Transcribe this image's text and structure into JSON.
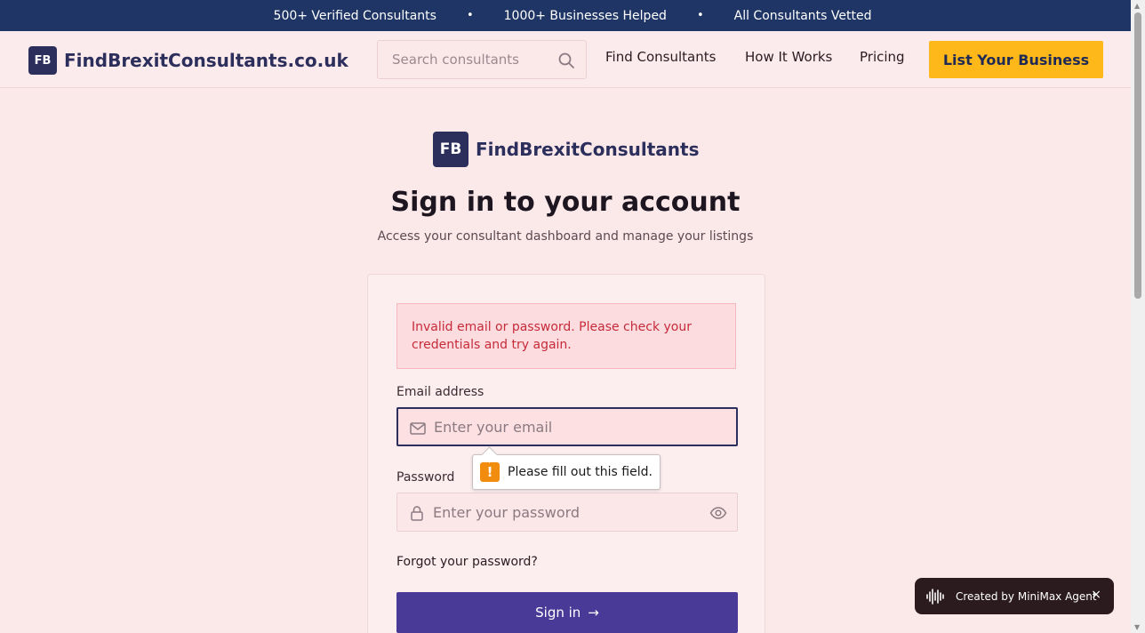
{
  "topbar": {
    "items": [
      "500+ Verified Consultants",
      "1000+ Businesses Helped",
      "All Consultants Vetted"
    ],
    "separator": "•"
  },
  "header": {
    "logo_text": "FB",
    "brand_name": "FindBrexitConsultants.co.uk",
    "search_placeholder": "Search consultants",
    "nav": {
      "find": "Find Consultants",
      "how": "How It Works",
      "pricing": "Pricing"
    },
    "cta_label": "List Your Business"
  },
  "main": {
    "logo_text": "FB",
    "logo_name": "FindBrexitConsultants",
    "title": "Sign in to your account",
    "subtitle": "Access your consultant dashboard and manage your listings",
    "error": "Invalid email or password. Please check your credentials and try again.",
    "email_label": "Email address",
    "email_placeholder": "Enter your email",
    "tooltip": "Please fill out this field.",
    "tooltip_icon": "!",
    "password_label": "Password",
    "password_placeholder": "Enter your password",
    "forgot": "Forgot your password?",
    "signin_label": "Sign in",
    "signin_arrow": "→"
  },
  "badge": {
    "text": "Created by MiniMax Agent",
    "close": "×"
  },
  "colors": {
    "topbar": "#1f3566",
    "brand": "#2c2e5c",
    "cta": "#ffb819",
    "primary_button": "#4a3a97",
    "error_text": "#c62b3a",
    "background": "#fbe9ea"
  },
  "icons": [
    "search-icon",
    "mail-icon",
    "lock-icon",
    "eye-icon",
    "arrow-right-icon",
    "warning-icon",
    "waveform-icon",
    "close-icon"
  ]
}
